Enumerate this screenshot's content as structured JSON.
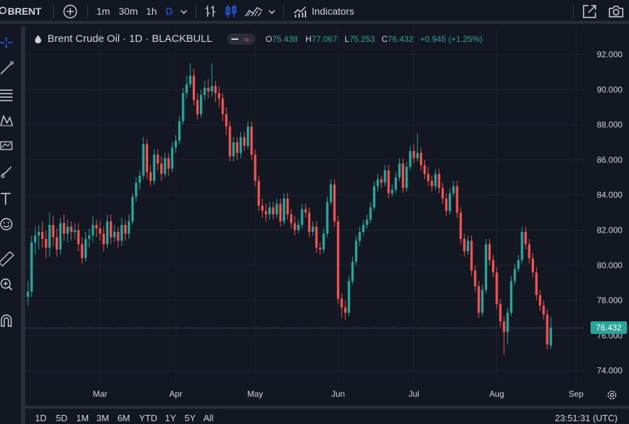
{
  "toolbar": {
    "symbol": "BRENT",
    "intervals": [
      "1m",
      "30m",
      "1h",
      "D"
    ],
    "active_interval": "D",
    "indicators_label": "Indicators"
  },
  "legend": {
    "title": "Brent Crude Oil · 1D · BLACKBULL",
    "o_label": "O",
    "o": "75.438",
    "h_label": "H",
    "h": "77.067",
    "l_label": "L",
    "l": "75.253",
    "c_label": "C",
    "c": "76.432",
    "change": "+0.945 (+1.25%)"
  },
  "price_tag": "76.432",
  "bottom": {
    "ranges": [
      "1D",
      "5D",
      "1M",
      "3M",
      "6M",
      "YTD",
      "1Y",
      "5Y",
      "All"
    ],
    "clock": "23:51:31 (UTC)"
  },
  "colors": {
    "up": "#26a69a",
    "down": "#ef5350",
    "background": "#131722",
    "grid": "#1f2430"
  },
  "chart_data": {
    "type": "candlestick",
    "title": "Brent Crude Oil · 1D · BLACKBULL",
    "ylim": [
      73.5,
      93.0
    ],
    "y_ticks": [
      "74.000",
      "76.000",
      "78.000",
      "80.000",
      "82.000",
      "84.000",
      "86.000",
      "88.000",
      "90.000",
      "92.000"
    ],
    "x_ticks": [
      {
        "label": "Mar",
        "index": 20
      },
      {
        "label": "Apr",
        "index": 41
      },
      {
        "label": "May",
        "index": 63
      },
      {
        "label": "Jun",
        "index": 86
      },
      {
        "label": "Jul",
        "index": 107
      },
      {
        "label": "Aug",
        "index": 130
      },
      {
        "label": "Sep",
        "index": 152
      }
    ],
    "last_price": 76.432,
    "grid": true,
    "closes": [
      78.5,
      81.3,
      81.7,
      81.9,
      81.5,
      81.0,
      82.3,
      81.6,
      80.9,
      82.4,
      81.8,
      82.2,
      81.9,
      82.0,
      81.2,
      80.4,
      81.5,
      81.7,
      82.3,
      82.1,
      81.8,
      81.2,
      82.5,
      81.6,
      81.9,
      81.4,
      82.3,
      81.8,
      82.5,
      83.9,
      84.7,
      85.1,
      86.9,
      85.3,
      84.8,
      86.3,
      85.8,
      85.2,
      86.1,
      85.5,
      86.7,
      87.1,
      88.2,
      89.8,
      90.3,
      90.8,
      89.4,
      88.6,
      89.7,
      90.1,
      89.9,
      90.2,
      89.8,
      89.5,
      88.6,
      87.9,
      86.2,
      87.0,
      86.4,
      87.3,
      86.8,
      87.9,
      86.3,
      84.8,
      83.4,
      83.1,
      82.9,
      83.3,
      82.9,
      83.5,
      82.5,
      83.8,
      82.9,
      82.4,
      82.0,
      82.3,
      83.2,
      83.0,
      81.9,
      82.2,
      81.0,
      80.9,
      81.8,
      83.6,
      84.6,
      82.5,
      78.1,
      77.6,
      77.3,
      79.1,
      80.2,
      81.4,
      81.9,
      82.3,
      82.6,
      83.3,
      84.5,
      84.9,
      84.7,
      85.4,
      84.1,
      84.3,
      85.0,
      85.8,
      84.4,
      85.6,
      86.5,
      86.1,
      86.4,
      85.7,
      85.2,
      84.8,
      84.5,
      85.2,
      84.4,
      83.8,
      83.1,
      84.1,
      84.5,
      83.0,
      81.5,
      80.8,
      81.4,
      79.7,
      78.8,
      77.3,
      78.6,
      81.2,
      80.3,
      79.6,
      77.8,
      76.8,
      76.2,
      77.3,
      79.1,
      79.8,
      80.3,
      81.9,
      81.2,
      80.4,
      79.6,
      78.3,
      77.7,
      77.2,
      75.5,
      76.432
    ],
    "candles": [
      {
        "o": 78.2,
        "h": 79.1,
        "l": 77.7,
        "c": 78.5
      },
      {
        "o": 78.5,
        "h": 81.7,
        "l": 78.2,
        "c": 81.3
      },
      {
        "o": 81.3,
        "h": 82.2,
        "l": 80.6,
        "c": 81.7
      },
      {
        "o": 81.7,
        "h": 82.3,
        "l": 80.9,
        "c": 81.9
      },
      {
        "o": 81.9,
        "h": 82.5,
        "l": 81.0,
        "c": 81.5
      },
      {
        "o": 81.5,
        "h": 82.0,
        "l": 80.4,
        "c": 81.0
      },
      {
        "o": 81.0,
        "h": 83.0,
        "l": 80.5,
        "c": 82.3
      },
      {
        "o": 82.3,
        "h": 82.8,
        "l": 81.1,
        "c": 81.6
      },
      {
        "o": 81.6,
        "h": 82.1,
        "l": 80.5,
        "c": 80.9
      },
      {
        "o": 80.9,
        "h": 82.7,
        "l": 80.6,
        "c": 82.4
      },
      {
        "o": 82.4,
        "h": 82.9,
        "l": 81.4,
        "c": 81.8
      },
      {
        "o": 81.8,
        "h": 82.6,
        "l": 81.3,
        "c": 82.2
      },
      {
        "o": 82.2,
        "h": 82.5,
        "l": 81.4,
        "c": 81.9
      },
      {
        "o": 81.9,
        "h": 82.4,
        "l": 81.5,
        "c": 82.0
      },
      {
        "o": 82.0,
        "h": 82.4,
        "l": 80.8,
        "c": 81.2
      },
      {
        "o": 81.2,
        "h": 81.6,
        "l": 80.1,
        "c": 80.4
      },
      {
        "o": 80.4,
        "h": 81.9,
        "l": 80.2,
        "c": 81.5
      },
      {
        "o": 81.5,
        "h": 82.1,
        "l": 81.0,
        "c": 81.7
      },
      {
        "o": 81.7,
        "h": 82.8,
        "l": 81.3,
        "c": 82.3
      },
      {
        "o": 82.3,
        "h": 82.6,
        "l": 81.6,
        "c": 82.1
      },
      {
        "o": 82.1,
        "h": 82.5,
        "l": 81.4,
        "c": 81.8
      },
      {
        "o": 81.8,
        "h": 82.2,
        "l": 80.8,
        "c": 81.2
      },
      {
        "o": 81.2,
        "h": 82.9,
        "l": 81.0,
        "c": 82.5
      },
      {
        "o": 82.5,
        "h": 82.9,
        "l": 81.2,
        "c": 81.6
      },
      {
        "o": 81.6,
        "h": 82.3,
        "l": 81.3,
        "c": 81.9
      },
      {
        "o": 81.9,
        "h": 82.2,
        "l": 81.0,
        "c": 81.4
      },
      {
        "o": 81.4,
        "h": 82.7,
        "l": 81.1,
        "c": 82.3
      },
      {
        "o": 82.3,
        "h": 82.6,
        "l": 81.4,
        "c": 81.8
      },
      {
        "o": 81.8,
        "h": 82.9,
        "l": 81.5,
        "c": 82.5
      },
      {
        "o": 82.5,
        "h": 84.1,
        "l": 82.3,
        "c": 83.9
      },
      {
        "o": 83.9,
        "h": 85.0,
        "l": 83.6,
        "c": 84.7
      },
      {
        "o": 84.7,
        "h": 85.4,
        "l": 84.3,
        "c": 85.1
      },
      {
        "o": 85.1,
        "h": 87.3,
        "l": 84.9,
        "c": 86.9
      },
      {
        "o": 86.9,
        "h": 87.2,
        "l": 84.9,
        "c": 85.3
      },
      {
        "o": 85.3,
        "h": 85.7,
        "l": 84.5,
        "c": 84.8
      },
      {
        "o": 84.8,
        "h": 86.6,
        "l": 84.6,
        "c": 86.3
      },
      {
        "o": 86.3,
        "h": 86.6,
        "l": 85.4,
        "c": 85.8
      },
      {
        "o": 85.8,
        "h": 86.2,
        "l": 84.8,
        "c": 85.2
      },
      {
        "o": 85.2,
        "h": 86.4,
        "l": 85.0,
        "c": 86.1
      },
      {
        "o": 86.1,
        "h": 86.4,
        "l": 85.1,
        "c": 85.5
      },
      {
        "o": 85.5,
        "h": 87.0,
        "l": 85.3,
        "c": 86.7
      },
      {
        "o": 86.7,
        "h": 87.4,
        "l": 86.4,
        "c": 87.1
      },
      {
        "o": 87.1,
        "h": 88.5,
        "l": 86.9,
        "c": 88.2
      },
      {
        "o": 88.2,
        "h": 90.1,
        "l": 88.0,
        "c": 89.8
      },
      {
        "o": 89.8,
        "h": 90.8,
        "l": 89.5,
        "c": 90.3
      },
      {
        "o": 90.3,
        "h": 91.5,
        "l": 90.1,
        "c": 90.8
      },
      {
        "o": 90.8,
        "h": 91.2,
        "l": 89.1,
        "c": 89.4
      },
      {
        "o": 89.4,
        "h": 89.8,
        "l": 88.3,
        "c": 88.6
      },
      {
        "o": 88.6,
        "h": 90.0,
        "l": 88.4,
        "c": 89.7
      },
      {
        "o": 89.7,
        "h": 90.5,
        "l": 89.4,
        "c": 90.1
      },
      {
        "o": 90.1,
        "h": 90.6,
        "l": 89.5,
        "c": 89.9
      },
      {
        "o": 89.9,
        "h": 91.5,
        "l": 89.6,
        "c": 90.2
      },
      {
        "o": 90.2,
        "h": 90.5,
        "l": 89.3,
        "c": 89.8
      },
      {
        "o": 89.8,
        "h": 90.2,
        "l": 89.0,
        "c": 89.5
      },
      {
        "o": 89.5,
        "h": 89.8,
        "l": 88.2,
        "c": 88.6
      },
      {
        "o": 88.6,
        "h": 89.0,
        "l": 87.4,
        "c": 87.9
      },
      {
        "o": 87.9,
        "h": 88.2,
        "l": 85.9,
        "c": 86.2
      },
      {
        "o": 86.2,
        "h": 87.3,
        "l": 85.9,
        "c": 87.0
      },
      {
        "o": 87.0,
        "h": 87.3,
        "l": 86.0,
        "c": 86.4
      },
      {
        "o": 86.4,
        "h": 87.6,
        "l": 86.1,
        "c": 87.3
      },
      {
        "o": 87.3,
        "h": 87.6,
        "l": 86.5,
        "c": 86.8
      },
      {
        "o": 86.8,
        "h": 88.2,
        "l": 86.6,
        "c": 87.9
      },
      {
        "o": 87.9,
        "h": 88.2,
        "l": 86.0,
        "c": 86.3
      },
      {
        "o": 86.3,
        "h": 86.6,
        "l": 84.5,
        "c": 84.8
      },
      {
        "o": 84.8,
        "h": 85.1,
        "l": 83.1,
        "c": 83.4
      },
      {
        "o": 83.4,
        "h": 83.8,
        "l": 82.7,
        "c": 83.1
      },
      {
        "o": 83.1,
        "h": 83.5,
        "l": 82.5,
        "c": 82.9
      },
      {
        "o": 82.9,
        "h": 83.6,
        "l": 82.6,
        "c": 83.3
      },
      {
        "o": 83.3,
        "h": 83.6,
        "l": 82.6,
        "c": 82.9
      },
      {
        "o": 82.9,
        "h": 83.8,
        "l": 82.7,
        "c": 83.5
      },
      {
        "o": 83.5,
        "h": 83.8,
        "l": 82.2,
        "c": 82.5
      },
      {
        "o": 82.5,
        "h": 84.1,
        "l": 82.3,
        "c": 83.8
      },
      {
        "o": 83.8,
        "h": 84.1,
        "l": 82.6,
        "c": 82.9
      },
      {
        "o": 82.9,
        "h": 83.2,
        "l": 82.1,
        "c": 82.4
      },
      {
        "o": 82.4,
        "h": 82.8,
        "l": 81.7,
        "c": 82.0
      },
      {
        "o": 82.0,
        "h": 82.6,
        "l": 81.8,
        "c": 82.3
      },
      {
        "o": 82.3,
        "h": 83.5,
        "l": 82.1,
        "c": 83.2
      },
      {
        "o": 83.2,
        "h": 83.5,
        "l": 82.7,
        "c": 83.0
      },
      {
        "o": 83.0,
        "h": 83.3,
        "l": 81.6,
        "c": 81.9
      },
      {
        "o": 81.9,
        "h": 82.5,
        "l": 81.7,
        "c": 82.2
      },
      {
        "o": 82.2,
        "h": 82.5,
        "l": 80.7,
        "c": 81.0
      },
      {
        "o": 81.0,
        "h": 81.3,
        "l": 80.6,
        "c": 80.9
      },
      {
        "o": 80.9,
        "h": 82.1,
        "l": 80.7,
        "c": 81.8
      },
      {
        "o": 81.8,
        "h": 83.9,
        "l": 81.6,
        "c": 83.6
      },
      {
        "o": 83.6,
        "h": 84.9,
        "l": 83.4,
        "c": 84.6
      },
      {
        "o": 84.6,
        "h": 84.9,
        "l": 82.2,
        "c": 82.5
      },
      {
        "o": 82.5,
        "h": 82.8,
        "l": 77.8,
        "c": 78.1
      },
      {
        "o": 78.1,
        "h": 78.4,
        "l": 77.0,
        "c": 77.6
      },
      {
        "o": 77.6,
        "h": 78.0,
        "l": 76.9,
        "c": 77.3
      },
      {
        "o": 77.3,
        "h": 79.4,
        "l": 77.1,
        "c": 79.1
      },
      {
        "o": 79.1,
        "h": 80.5,
        "l": 78.9,
        "c": 80.2
      },
      {
        "o": 80.2,
        "h": 81.7,
        "l": 80.0,
        "c": 81.4
      },
      {
        "o": 81.4,
        "h": 82.2,
        "l": 81.1,
        "c": 81.9
      },
      {
        "o": 81.9,
        "h": 82.6,
        "l": 81.7,
        "c": 82.3
      },
      {
        "o": 82.3,
        "h": 82.9,
        "l": 82.1,
        "c": 82.6
      },
      {
        "o": 82.6,
        "h": 83.6,
        "l": 82.4,
        "c": 83.3
      },
      {
        "o": 83.3,
        "h": 84.8,
        "l": 83.1,
        "c": 84.5
      },
      {
        "o": 84.5,
        "h": 85.2,
        "l": 84.2,
        "c": 84.9
      },
      {
        "o": 84.9,
        "h": 85.1,
        "l": 84.4,
        "c": 84.7
      },
      {
        "o": 84.7,
        "h": 85.7,
        "l": 84.5,
        "c": 85.4
      },
      {
        "o": 85.4,
        "h": 85.7,
        "l": 83.8,
        "c": 84.1
      },
      {
        "o": 84.1,
        "h": 84.6,
        "l": 83.9,
        "c": 84.3
      },
      {
        "o": 84.3,
        "h": 85.3,
        "l": 84.1,
        "c": 85.0
      },
      {
        "o": 85.0,
        "h": 86.1,
        "l": 84.8,
        "c": 85.8
      },
      {
        "o": 85.8,
        "h": 86.1,
        "l": 84.1,
        "c": 84.4
      },
      {
        "o": 84.4,
        "h": 85.9,
        "l": 84.2,
        "c": 85.6
      },
      {
        "o": 85.6,
        "h": 86.8,
        "l": 85.4,
        "c": 86.5
      },
      {
        "o": 86.5,
        "h": 86.9,
        "l": 85.8,
        "c": 86.1
      },
      {
        "o": 86.1,
        "h": 87.5,
        "l": 85.9,
        "c": 86.4
      },
      {
        "o": 86.4,
        "h": 86.7,
        "l": 85.4,
        "c": 85.7
      },
      {
        "o": 85.7,
        "h": 86.0,
        "l": 84.9,
        "c": 85.2
      },
      {
        "o": 85.2,
        "h": 85.6,
        "l": 84.5,
        "c": 84.8
      },
      {
        "o": 84.8,
        "h": 85.1,
        "l": 84.2,
        "c": 84.5
      },
      {
        "o": 84.5,
        "h": 85.5,
        "l": 84.3,
        "c": 85.2
      },
      {
        "o": 85.2,
        "h": 85.5,
        "l": 84.1,
        "c": 84.4
      },
      {
        "o": 84.4,
        "h": 84.7,
        "l": 83.5,
        "c": 83.8
      },
      {
        "o": 83.8,
        "h": 84.1,
        "l": 82.8,
        "c": 83.1
      },
      {
        "o": 83.1,
        "h": 84.4,
        "l": 82.9,
        "c": 84.1
      },
      {
        "o": 84.1,
        "h": 84.8,
        "l": 83.9,
        "c": 84.5
      },
      {
        "o": 84.5,
        "h": 84.8,
        "l": 82.7,
        "c": 83.0
      },
      {
        "o": 83.0,
        "h": 83.3,
        "l": 81.2,
        "c": 81.5
      },
      {
        "o": 81.5,
        "h": 81.8,
        "l": 80.5,
        "c": 80.8
      },
      {
        "o": 80.8,
        "h": 81.7,
        "l": 80.6,
        "c": 81.4
      },
      {
        "o": 81.4,
        "h": 81.7,
        "l": 79.4,
        "c": 79.7
      },
      {
        "o": 79.7,
        "h": 80.0,
        "l": 78.5,
        "c": 78.8
      },
      {
        "o": 78.8,
        "h": 79.1,
        "l": 77.0,
        "c": 77.3
      },
      {
        "o": 77.3,
        "h": 78.9,
        "l": 77.1,
        "c": 78.6
      },
      {
        "o": 78.6,
        "h": 81.5,
        "l": 78.4,
        "c": 81.2
      },
      {
        "o": 81.2,
        "h": 81.5,
        "l": 80.0,
        "c": 80.3
      },
      {
        "o": 80.3,
        "h": 80.6,
        "l": 79.3,
        "c": 79.6
      },
      {
        "o": 79.6,
        "h": 79.9,
        "l": 77.5,
        "c": 77.8
      },
      {
        "o": 77.8,
        "h": 78.1,
        "l": 76.5,
        "c": 76.8
      },
      {
        "o": 76.8,
        "h": 77.1,
        "l": 74.9,
        "c": 76.2
      },
      {
        "o": 76.2,
        "h": 77.6,
        "l": 75.5,
        "c": 77.3
      },
      {
        "o": 77.3,
        "h": 79.4,
        "l": 77.1,
        "c": 79.1
      },
      {
        "o": 79.1,
        "h": 80.1,
        "l": 78.9,
        "c": 79.8
      },
      {
        "o": 79.8,
        "h": 80.6,
        "l": 79.6,
        "c": 80.3
      },
      {
        "o": 80.3,
        "h": 82.2,
        "l": 80.1,
        "c": 81.9
      },
      {
        "o": 81.9,
        "h": 82.2,
        "l": 80.9,
        "c": 81.2
      },
      {
        "o": 81.2,
        "h": 81.5,
        "l": 80.1,
        "c": 80.4
      },
      {
        "o": 80.4,
        "h": 80.7,
        "l": 79.3,
        "c": 79.6
      },
      {
        "o": 79.6,
        "h": 79.9,
        "l": 78.0,
        "c": 78.3
      },
      {
        "o": 78.3,
        "h": 78.6,
        "l": 77.4,
        "c": 77.7
      },
      {
        "o": 77.7,
        "h": 78.0,
        "l": 76.9,
        "c": 77.2
      },
      {
        "o": 77.2,
        "h": 77.5,
        "l": 75.2,
        "c": 75.5
      },
      {
        "o": 75.438,
        "h": 77.067,
        "l": 75.253,
        "c": 76.432
      }
    ]
  }
}
